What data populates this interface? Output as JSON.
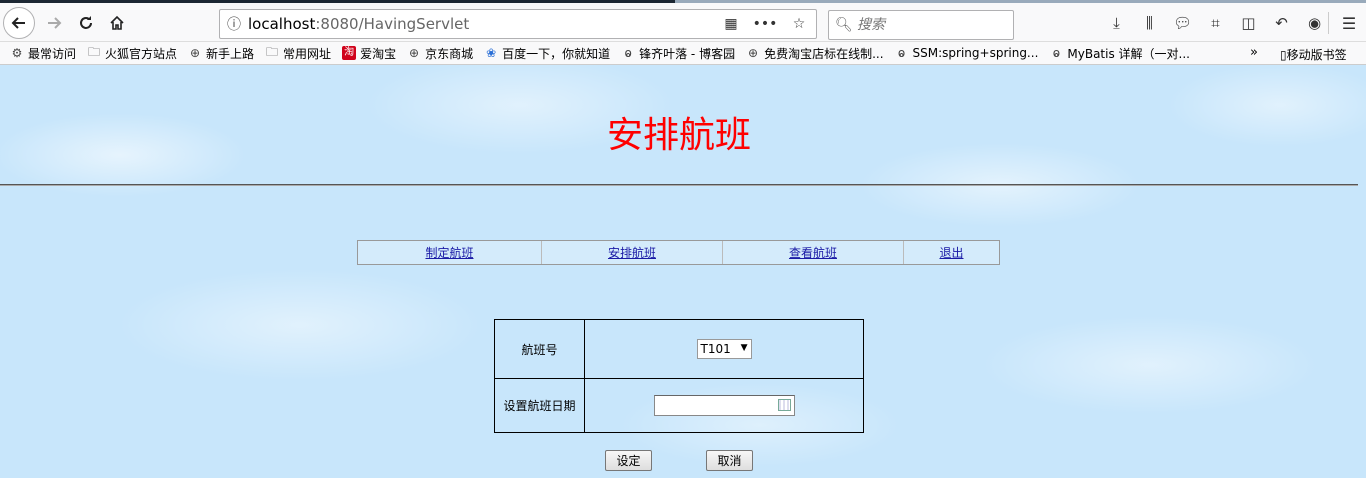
{
  "browser": {
    "url_host": "localhost",
    "url_port_path": ":8080/HavingServlet",
    "search_placeholder": "搜索"
  },
  "bookmarks": [
    {
      "label": "最常访问",
      "icon": "gear-icon"
    },
    {
      "label": "火狐官方站点",
      "icon": "folder-icon"
    },
    {
      "label": "新手上路",
      "icon": "globe-icon"
    },
    {
      "label": "常用网址",
      "icon": "folder-icon"
    },
    {
      "label": "爱淘宝",
      "icon": "taobao-icon"
    },
    {
      "label": "京东商城",
      "icon": "globe-icon"
    },
    {
      "label": "百度一下，你就知道",
      "icon": "baidu-paw-icon"
    },
    {
      "label": "锋齐叶落 - 博客园",
      "icon": "cnblogs-icon"
    },
    {
      "label": "免费淘宝店标在线制...",
      "icon": "globe-icon"
    },
    {
      "label": "SSM:spring+spring...",
      "icon": "cnblogs-icon"
    },
    {
      "label": "MyBatis 详解（一对...",
      "icon": "cnblogs-icon"
    }
  ],
  "bookmarks_more": "»",
  "mobile_bookmarks": "移动版书签",
  "page": {
    "title": "安排航班",
    "nav": [
      "制定航班",
      "安排航班",
      "查看航班",
      "退出"
    ],
    "form": {
      "flight_label": "航班号",
      "flight_value": "T101",
      "date_label": "设置航班日期",
      "date_value": ""
    },
    "buttons": {
      "set": "设定",
      "cancel": "取消"
    }
  }
}
